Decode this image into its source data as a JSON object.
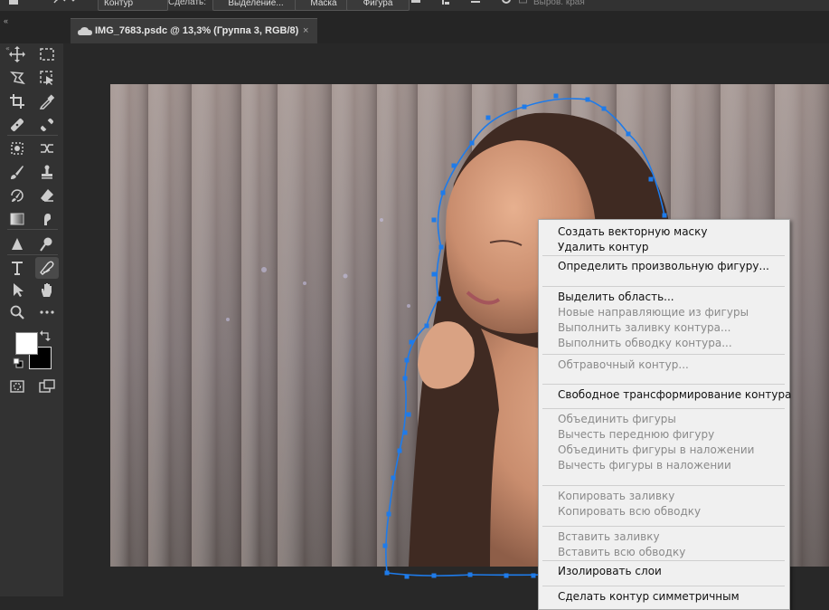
{
  "options_bar": {
    "mode_select": "Контур",
    "make_label": "Сделать:",
    "selection_button": "Выделение...",
    "mask_button": "Маска",
    "shape_button": "Фигура",
    "auto_edges_label": "Выров. края"
  },
  "document_tab": {
    "title": "IMG_7683.psdc @ 13,3% (Группа 3, RGB/8)",
    "close_glyph": "×",
    "collapse_glyph": "«"
  },
  "toolbar": {
    "tools": [
      "move-icon",
      "marquee-icon",
      "lasso-icon",
      "object-select-icon",
      "crop-icon",
      "eyedropper-icon",
      "healing-brush-icon",
      "patch-icon",
      "content-aware-icon",
      "remix-icon",
      "brush-icon",
      "stamp-icon",
      "history-brush-icon",
      "eraser-icon",
      "gradient-icon",
      "smudge-icon",
      "sharpen-icon",
      "dodge-icon",
      "type-icon",
      "pen-icon",
      "path-select-icon",
      "hand-icon",
      "zoom-icon",
      "more-icon",
      "quick-mask-icon",
      "screen-mode-icon"
    ],
    "active_tool": "pen-icon",
    "foreground_color": "#ffffff",
    "background_color": "#000000"
  },
  "context_menu": {
    "groups": [
      [
        {
          "label": "Создать векторную маску",
          "enabled": true
        },
        {
          "label": "Удалить контур",
          "enabled": true
        }
      ],
      [
        {
          "label": "Определить произвольную фигуру...",
          "enabled": true
        }
      ],
      [
        {
          "label": "Выделить область...",
          "enabled": true
        },
        {
          "label": "Новые направляющие из фигуры",
          "enabled": false
        },
        {
          "label": "Выполнить заливку контура...",
          "enabled": false
        },
        {
          "label": "Выполнить обводку контура...",
          "enabled": false
        }
      ],
      [
        {
          "label": "Обтравочный контур...",
          "enabled": false
        }
      ],
      [
        {
          "label": "Свободное трансформирование контура",
          "enabled": true
        }
      ],
      [
        {
          "label": "Объединить фигуры",
          "enabled": false
        },
        {
          "label": "Вычесть переднюю фигуру",
          "enabled": false
        },
        {
          "label": "Объединить фигуры в наложении",
          "enabled": false
        },
        {
          "label": "Вычесть фигуры в наложении",
          "enabled": false
        }
      ],
      [
        {
          "label": "Копировать заливку",
          "enabled": false
        },
        {
          "label": "Копировать всю обводку",
          "enabled": false
        }
      ],
      [
        {
          "label": "Вставить заливку",
          "enabled": false
        },
        {
          "label": "Вставить всю обводку",
          "enabled": false
        }
      ],
      [
        {
          "label": "Изолировать слои",
          "enabled": true
        }
      ],
      [
        {
          "label": "Сделать контур симметричным",
          "enabled": true
        }
      ]
    ]
  },
  "colors": {
    "path_anchor": "#1e7bea",
    "annotation_arrow": "#e53935"
  }
}
